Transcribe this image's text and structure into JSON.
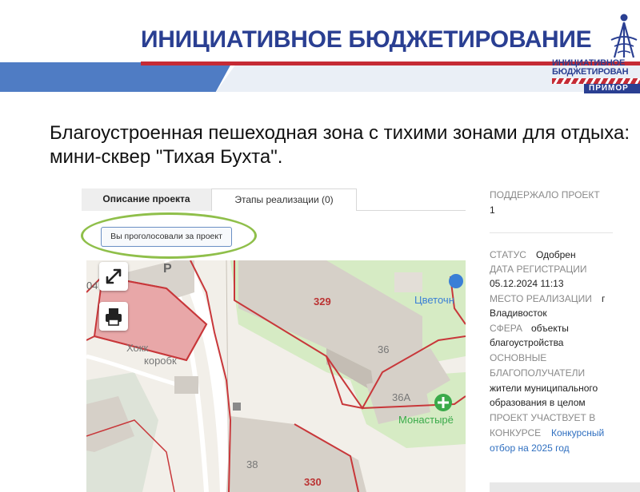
{
  "header": {
    "site_title": "ИНИЦИАТИВНОЕ БЮДЖЕТИРОВАНИЕ",
    "logo_line1": "ИНИЦИАТИВНОЕ",
    "logo_line2": "БЮДЖЕТИРОВАН",
    "logo_region": "ПРИМОР",
    "colors": {
      "brand_blue": "#2a3f92",
      "accent_red": "#c52b35",
      "banner_blue": "#4f7cc4"
    }
  },
  "project": {
    "title": "Благоустроенная пешеходная зона с тихими зонами для отдыха: мини-сквер \"Тихая Бухта\"."
  },
  "tabs": [
    {
      "label": "Описание проекта",
      "active": true
    },
    {
      "label": "Этапы реализации (0)",
      "active": false
    }
  ],
  "vote": {
    "label": "Вы проголосовали за проект"
  },
  "map": {
    "labels": {
      "p": "Р",
      "partial_num": "04",
      "hockey1": "Хокк",
      "hockey2": "коробк",
      "b329": "329",
      "b36": "36",
      "b36a": "36А",
      "b38": "38",
      "b330": "330",
      "flowers": "Цветочн",
      "monastery": "Монастырё"
    },
    "controls": [
      "expand-icon",
      "print-icon"
    ]
  },
  "sidebar": {
    "supported_label": "ПОДДЕРЖАЛО ПРОЕКТ",
    "supported_value": "1",
    "status_label": "СТАТУС",
    "status_value": "Одобрен",
    "reg_label": "ДАТА РЕГИСТРАЦИИ",
    "reg_value": "05.12.2024 11:13",
    "place_label": "МЕСТО РЕАЛИЗАЦИИ",
    "place_value1": "г",
    "place_value2": "Владивосток",
    "sphere_label": "СФЕРА",
    "sphere_value1": "объекты",
    "sphere_value2": "благоустройства",
    "beneficiaries_label1": "ОСНОВНЫЕ",
    "beneficiaries_label2": "БЛАГОПОЛУЧАТЕЛИ",
    "beneficiaries_value1": "жители муниципального",
    "beneficiaries_value2": "образования в целом",
    "contest_label1": "ПРОЕКТ УЧАСТВУЕТ В",
    "contest_label2": "КОНКУРСЕ",
    "contest_value1": "Конкурсный",
    "contest_value2": "отбор на 2025 год"
  }
}
